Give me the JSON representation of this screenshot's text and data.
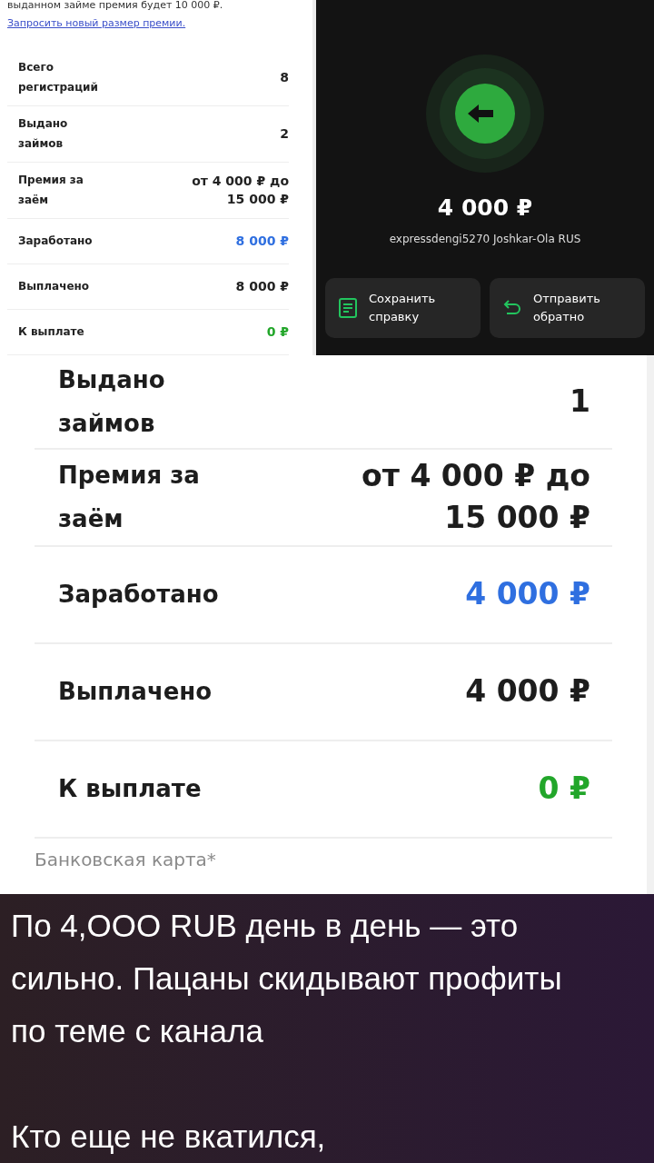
{
  "left_panel": {
    "cut_text": "выданном займе премия будет 10 000 ₽.",
    "link": "Запросить новый размер премии.",
    "rows": [
      {
        "label": "Всего регистраций",
        "value": "8"
      },
      {
        "label": "Выдано займов",
        "value": "2"
      },
      {
        "label": "Премия за заём",
        "value": "от 4 000 ₽ до 15 000 ₽"
      },
      {
        "label": "Заработано",
        "value": "8 000 ₽",
        "color": "#2f6fe0"
      },
      {
        "label": "Выплачено",
        "value": "8 000 ₽"
      },
      {
        "label": "К выплате",
        "value": "0 ₽",
        "color": "#22a62a"
      }
    ]
  },
  "right_panel": {
    "amount": "4 000 ₽",
    "merchant": "expressdengi5270 Joshkar-Ola RUS",
    "buttons": [
      {
        "kind": "document",
        "label": "Сохранить справку"
      },
      {
        "kind": "return",
        "label": "Отправить обратно"
      }
    ]
  },
  "main_card": {
    "rows": [
      {
        "label": "Выдано займов",
        "value": "1"
      },
      {
        "label": "Премия за заём",
        "value": "от 4 000 ₽ до 15 000 ₽"
      },
      {
        "label": "Заработано",
        "value": "4 000 ₽",
        "color": "#2f6fe0"
      },
      {
        "label": "Выплачено",
        "value": "4 000 ₽"
      },
      {
        "label": "К выплате",
        "value": "0 ₽",
        "color": "#22a62a"
      }
    ],
    "field_label": "Банковская карта*"
  },
  "caption": {
    "paragraphs": [
      "По 4,ООО RUB день в день — это сильно. Пацаны скидывают профиты по теме с канала",
      "Кто еще не вкатился,"
    ]
  }
}
